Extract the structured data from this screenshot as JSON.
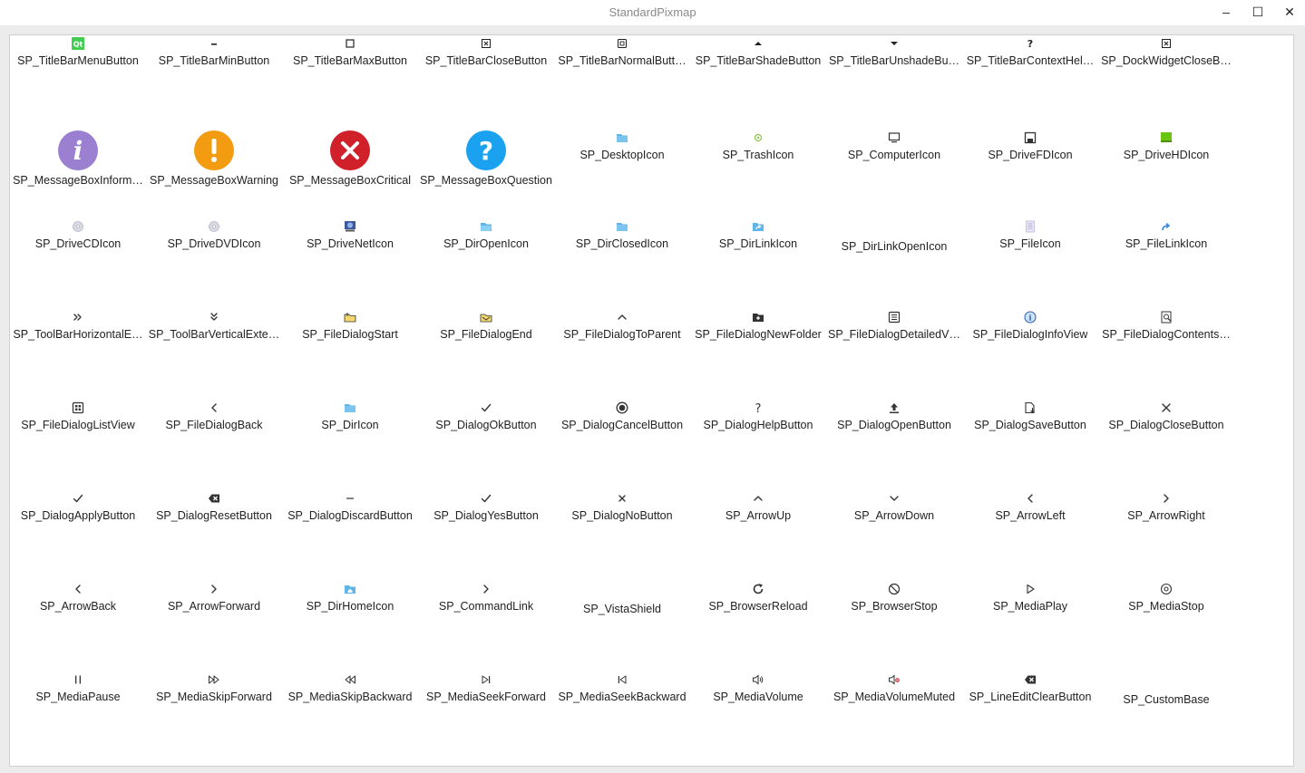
{
  "window": {
    "title": "StandardPixmap",
    "min_glyph": "–",
    "max_glyph": "☐",
    "close_glyph": "✕"
  },
  "items": [
    {
      "name": "SP_TitleBarMenuButton",
      "icon": "qt-logo-icon"
    },
    {
      "name": "SP_TitleBarMinButton",
      "icon": "minimize-icon"
    },
    {
      "name": "SP_TitleBarMaxButton",
      "icon": "maximize-icon"
    },
    {
      "name": "SP_TitleBarCloseButton",
      "icon": "close-box-icon"
    },
    {
      "name": "SP_TitleBarNormalButt…",
      "icon": "restore-icon"
    },
    {
      "name": "SP_TitleBarShadeButton",
      "icon": "shade-up-icon"
    },
    {
      "name": "SP_TitleBarUnshadeBu…",
      "icon": "shade-down-icon"
    },
    {
      "name": "SP_TitleBarContextHel…",
      "icon": "help-small-icon"
    },
    {
      "name": "SP_DockWidgetCloseB…",
      "icon": "close-box-icon"
    },
    {
      "name": "SP_MessageBoxInform…",
      "icon": "information-icon"
    },
    {
      "name": "SP_MessageBoxWarning",
      "icon": "warning-icon"
    },
    {
      "name": "SP_MessageBoxCritical",
      "icon": "critical-icon"
    },
    {
      "name": "SP_MessageBoxQuestion",
      "icon": "question-icon"
    },
    {
      "name": "SP_DesktopIcon",
      "icon": "folder-blue-icon"
    },
    {
      "name": "SP_TrashIcon",
      "icon": "trash-icon"
    },
    {
      "name": "SP_ComputerIcon",
      "icon": "computer-icon"
    },
    {
      "name": "SP_DriveFDIcon",
      "icon": "floppy-icon"
    },
    {
      "name": "SP_DriveHDIcon",
      "icon": "harddrive-icon"
    },
    {
      "name": "SP_DriveCDIcon",
      "icon": "cd-icon"
    },
    {
      "name": "SP_DriveDVDIcon",
      "icon": "dvd-icon"
    },
    {
      "name": "SP_DriveNetIcon",
      "icon": "network-drive-icon"
    },
    {
      "name": "SP_DirOpenIcon",
      "icon": "folder-open-icon"
    },
    {
      "name": "SP_DirClosedIcon",
      "icon": "folder-closed-icon"
    },
    {
      "name": "SP_DirLinkIcon",
      "icon": "folder-link-icon"
    },
    {
      "name": "SP_DirLinkOpenIcon",
      "icon": ""
    },
    {
      "name": "SP_FileIcon",
      "icon": "file-icon"
    },
    {
      "name": "SP_FileLinkIcon",
      "icon": "file-link-icon"
    },
    {
      "name": "SP_ToolBarHorizontalE…",
      "icon": "double-chevron-right-icon"
    },
    {
      "name": "SP_ToolBarVerticalExte…",
      "icon": "double-chevron-down-icon"
    },
    {
      "name": "SP_FileDialogStart",
      "icon": "folder-start-icon"
    },
    {
      "name": "SP_FileDialogEnd",
      "icon": "folder-end-icon"
    },
    {
      "name": "SP_FileDialogToParent",
      "icon": "chevron-up-icon"
    },
    {
      "name": "SP_FileDialogNewFolder",
      "icon": "new-folder-icon"
    },
    {
      "name": "SP_FileDialogDetailedV…",
      "icon": "detailed-view-icon"
    },
    {
      "name": "SP_FileDialogInfoView",
      "icon": "info-view-icon"
    },
    {
      "name": "SP_FileDialogContents…",
      "icon": "contents-view-icon"
    },
    {
      "name": "SP_FileDialogListView",
      "icon": "list-view-icon"
    },
    {
      "name": "SP_FileDialogBack",
      "icon": "chevron-left-icon"
    },
    {
      "name": "SP_DirIcon",
      "icon": "folder-blue-icon"
    },
    {
      "name": "SP_DialogOkButton",
      "icon": "checkmark-icon"
    },
    {
      "name": "SP_DialogCancelButton",
      "icon": "cancel-circle-icon"
    },
    {
      "name": "SP_DialogHelpButton",
      "icon": "question-mark-icon"
    },
    {
      "name": "SP_DialogOpenButton",
      "icon": "upload-icon"
    },
    {
      "name": "SP_DialogSaveButton",
      "icon": "save-file-icon"
    },
    {
      "name": "SP_DialogCloseButton",
      "icon": "close-icon"
    },
    {
      "name": "SP_DialogApplyButton",
      "icon": "checkmark-icon"
    },
    {
      "name": "SP_DialogResetButton",
      "icon": "backspace-icon"
    },
    {
      "name": "SP_DialogDiscardButton",
      "icon": "dash-icon"
    },
    {
      "name": "SP_DialogYesButton",
      "icon": "checkmark-icon"
    },
    {
      "name": "SP_DialogNoButton",
      "icon": "x-small-icon"
    },
    {
      "name": "SP_ArrowUp",
      "icon": "chevron-up-icon"
    },
    {
      "name": "SP_ArrowDown",
      "icon": "chevron-down-icon"
    },
    {
      "name": "SP_ArrowLeft",
      "icon": "chevron-left-icon"
    },
    {
      "name": "SP_ArrowRight",
      "icon": "chevron-right-icon"
    },
    {
      "name": "SP_ArrowBack",
      "icon": "chevron-left-icon"
    },
    {
      "name": "SP_ArrowForward",
      "icon": "chevron-right-icon"
    },
    {
      "name": "SP_DirHomeIcon",
      "icon": "folder-home-icon"
    },
    {
      "name": "SP_CommandLink",
      "icon": "chevron-right-icon"
    },
    {
      "name": "SP_VistaShield",
      "icon": ""
    },
    {
      "name": "SP_BrowserReload",
      "icon": "reload-icon"
    },
    {
      "name": "SP_BrowserStop",
      "icon": "stop-circle-icon"
    },
    {
      "name": "SP_MediaPlay",
      "icon": "play-icon"
    },
    {
      "name": "SP_MediaStop",
      "icon": "media-stop-icon"
    },
    {
      "name": "SP_MediaPause",
      "icon": "pause-icon"
    },
    {
      "name": "SP_MediaSkipForward",
      "icon": "skip-forward-icon"
    },
    {
      "name": "SP_MediaSkipBackward",
      "icon": "skip-backward-icon"
    },
    {
      "name": "SP_MediaSeekForward",
      "icon": "seek-forward-icon"
    },
    {
      "name": "SP_MediaSeekBackward",
      "icon": "seek-backward-icon"
    },
    {
      "name": "SP_MediaVolume",
      "icon": "volume-icon"
    },
    {
      "name": "SP_MediaVolumeMuted",
      "icon": "volume-muted-icon"
    },
    {
      "name": "SP_LineEditClearButton",
      "icon": "backspace-icon"
    },
    {
      "name": "SP_CustomBase",
      "icon": ""
    }
  ],
  "colors": {
    "info": "#9b7fd0",
    "warning": "#f39c12",
    "critical": "#d0202a",
    "question": "#1aa1ef",
    "folder": "#5fb4ea",
    "harddrive": "#6bc312"
  }
}
